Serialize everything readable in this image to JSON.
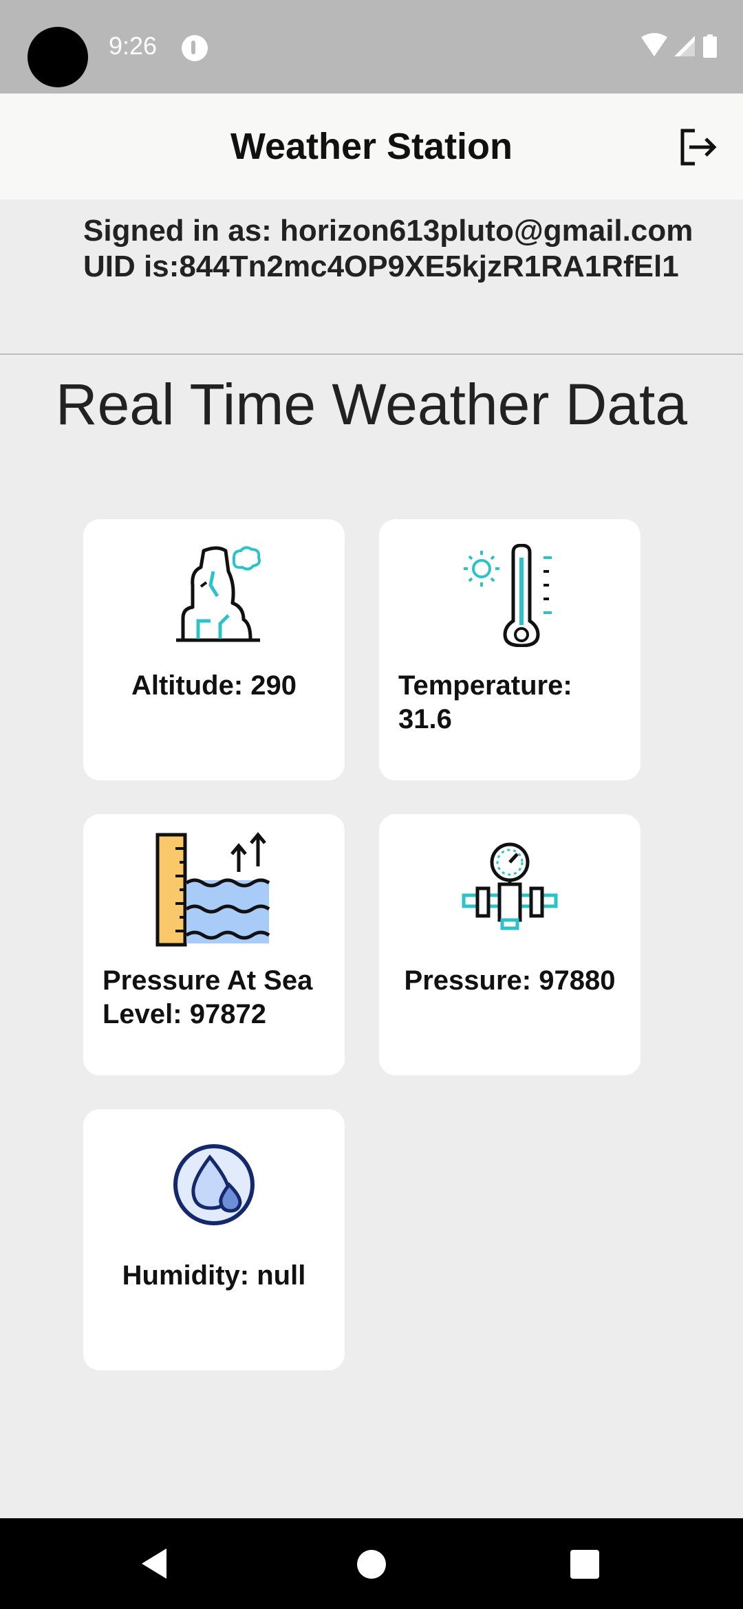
{
  "status_bar": {
    "time": "9:26",
    "icons": [
      "wifi-icon",
      "signal-icon",
      "battery-icon"
    ]
  },
  "app_bar": {
    "title": "Weather Station",
    "logout_icon": "logout-icon"
  },
  "user": {
    "signed_in_line": "Signed in as: horizon613pluto@gmail.com",
    "uid_line": "UID is:844Tn2mc4OP9XE5kjzR1RA1RfEl1"
  },
  "section_title": "Real Time Weather Data",
  "cards": [
    {
      "icon": "altitude-icon",
      "label": "Altitude: 290"
    },
    {
      "icon": "thermometer-icon",
      "label": "Temperature: 31.6"
    },
    {
      "icon": "sea-level-icon",
      "label": "Pressure At Sea Level: 97872"
    },
    {
      "icon": "pressure-gauge-icon",
      "label": "Pressure: 97880"
    },
    {
      "icon": "humidity-drop-icon",
      "label": "Humidity: null"
    }
  ],
  "colors": {
    "accent_teal": "#2bc3c8",
    "status_bar": "#b8b8b8",
    "background": "#ededed",
    "water_blue": "#a9cbf7",
    "ruler_yellow": "#f9c86b",
    "humidity_navy": "#13296b"
  },
  "nav_bar": {
    "buttons": [
      "back-icon",
      "home-icon",
      "recents-icon"
    ]
  }
}
